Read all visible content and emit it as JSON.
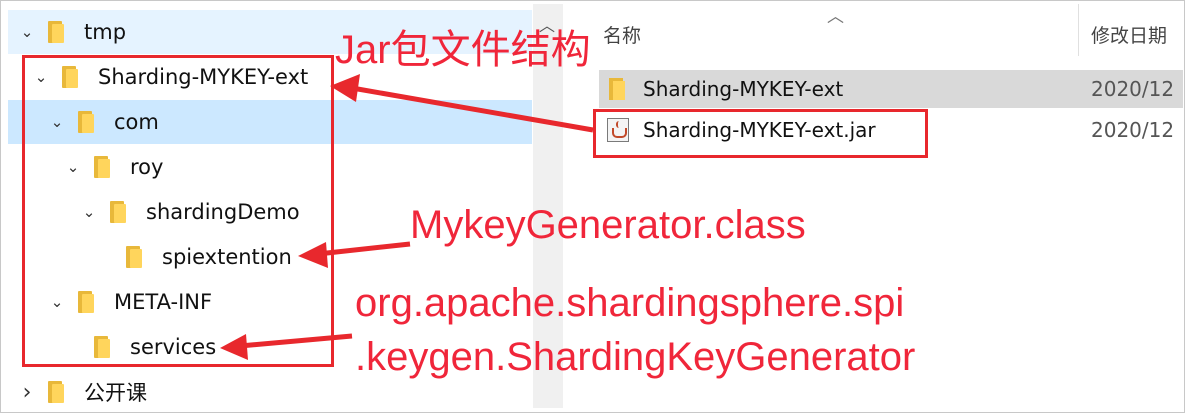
{
  "tree": {
    "items": [
      {
        "label": "tmp",
        "chevron": "⌄"
      },
      {
        "label": "Sharding-MYKEY-ext",
        "chevron": "⌄"
      },
      {
        "label": "com",
        "chevron": "⌄"
      },
      {
        "label": "roy",
        "chevron": "⌄"
      },
      {
        "label": "shardingDemo",
        "chevron": "⌄"
      },
      {
        "label": "spiextention",
        "chevron": ""
      },
      {
        "label": "META-INF",
        "chevron": "⌄"
      },
      {
        "label": "services",
        "chevron": ""
      },
      {
        "label": "公开课",
        "chevron": "›"
      }
    ]
  },
  "list": {
    "header_name": "名称",
    "header_date": "修改日期",
    "files": [
      {
        "name": "Sharding-MYKEY-ext",
        "date": "2020/12",
        "icon": "folder-icon"
      },
      {
        "name": "Sharding-MYKEY-ext.jar",
        "date": "2020/12",
        "icon": "java-jar-icon"
      }
    ]
  },
  "annotations": {
    "jar_structure": "Jar包文件结构",
    "class_file": "MykeyGenerator.class",
    "spi_line1": "org.apache.shardingsphere.spi",
    "spi_line2": ".keygen.ShardingKeyGenerator"
  },
  "colors": {
    "annotation_red": "#f0263a",
    "selection_blue": "#cce8ff",
    "folder_yellow": "#ffd55c"
  }
}
